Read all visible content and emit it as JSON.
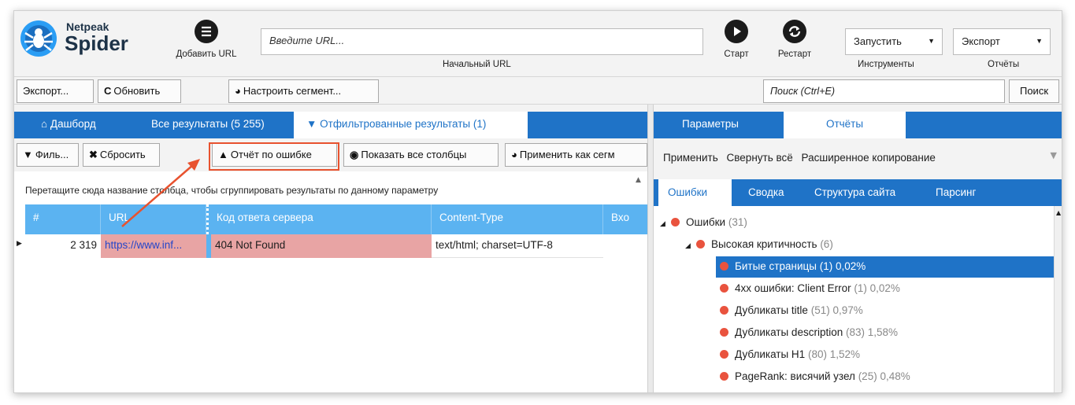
{
  "app": {
    "brand": "Netpeak",
    "product": "Spider"
  },
  "top": {
    "add_url_label": "Добавить URL",
    "url_placeholder": "Введите URL...",
    "url_caption": "Начальный URL",
    "start_label": "Старт",
    "restart_label": "Рестарт",
    "tools_value": "Запустить",
    "tools_caption": "Инструменты",
    "export_value": "Экспорт",
    "export_caption": "Отчёты"
  },
  "toolbar2": {
    "export_label": "Экспорт...",
    "refresh_label": "Обновить",
    "segment_label": "Настроить сегмент...",
    "search_placeholder": "Поиск (Ctrl+E)",
    "search_button": "Поиск"
  },
  "left": {
    "tabs": [
      "Дашборд",
      "Все результаты (5 255)",
      "Отфильтрованные результаты (1)"
    ],
    "filter_label": "Филь...",
    "reset_label": "Сбросить",
    "error_report_label": "Отчёт по ошибке",
    "show_columns_label": "Показать все столбцы",
    "apply_segment_label": "Применить как сегм",
    "group_hint": "Перетащите сюда название столбца, чтобы сгруппировать результаты по данному параметру",
    "columns": [
      "#",
      "URL",
      "Код ответа сервера",
      "Content-Type",
      "Вхо"
    ],
    "row": {
      "num": "2 319",
      "url": "https://www.inf...",
      "status": "404 Not Found",
      "content_type": "text/html; charset=UTF-8"
    }
  },
  "right": {
    "tabs": [
      "Параметры",
      "Отчёты"
    ],
    "actions": [
      "Применить",
      "Свернуть всё",
      "Расширенное копирование"
    ],
    "subtabs": [
      "Ошибки",
      "Сводка",
      "Структура сайта",
      "Парсинг"
    ],
    "tree": [
      {
        "label": "Ошибки",
        "count": "(31)"
      },
      {
        "label": "Высокая критичность",
        "count": "(6)"
      },
      {
        "label": "Битые страницы",
        "count": "(1) 0,02%"
      },
      {
        "label": "4xx ошибки: Client Error",
        "count": "(1) 0,02%"
      },
      {
        "label": "Дубликаты title",
        "count": "(51) 0,97%"
      },
      {
        "label": "Дубликаты description",
        "count": "(83) 1,58%"
      },
      {
        "label": "Дубликаты H1",
        "count": "(80) 1,52%"
      },
      {
        "label": "PageRank: висячий узел",
        "count": "(25) 0,48%"
      }
    ]
  },
  "colors": {
    "accent": "#1f73c7",
    "grid_header": "#5bb3f1",
    "error_dot": "#e9533e",
    "highlight_cell": "#e8a4a4",
    "callout": "#e8522f"
  }
}
